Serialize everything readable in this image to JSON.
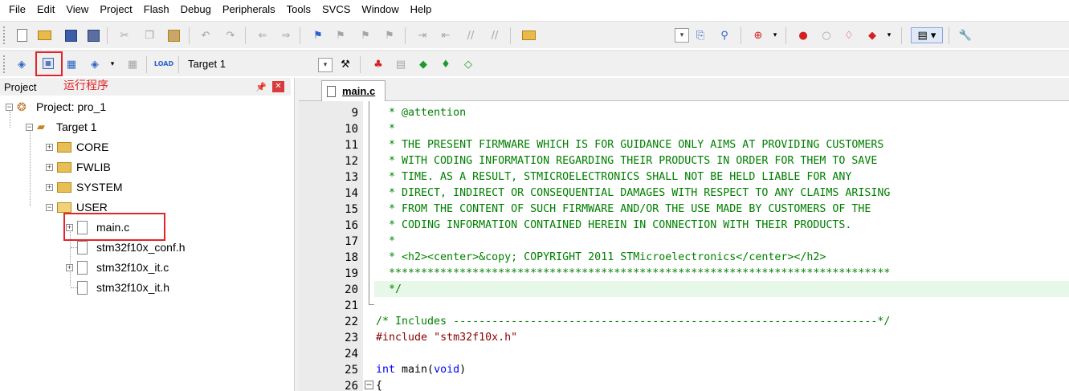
{
  "menu": [
    "File",
    "Edit",
    "View",
    "Project",
    "Flash",
    "Debug",
    "Peripherals",
    "Tools",
    "SVCS",
    "Window",
    "Help"
  ],
  "toolbar": {
    "target": "Target 1",
    "icons": [
      "new-file",
      "open",
      "save",
      "save-all",
      "cut",
      "copy",
      "paste",
      "undo",
      "redo",
      "navigate-back",
      "navigate-forward",
      "bookmark",
      "prev-bookmark",
      "next-bookmark",
      "clear-bookmarks",
      "indent",
      "unindent",
      "comment",
      "uncomment",
      "find-in-files",
      "find",
      "debug-session",
      "breakpoint",
      "step",
      "configure",
      "translate",
      "build",
      "rebuild",
      "batch-build",
      "stop-build",
      "download",
      "target-options",
      "manage-components"
    ]
  },
  "annotations": {
    "run_caption": "运行程序",
    "highlight_color": "#e2252b"
  },
  "project_panel": {
    "title": "Project",
    "tree": {
      "project": "Project: pro_1",
      "target": "Target 1",
      "groups": [
        "CORE",
        "FWLIB",
        "SYSTEM",
        "USER"
      ],
      "files": [
        "main.c",
        "stm32f10x_conf.h",
        "stm32f10x_it.c",
        "stm32f10x_it.h"
      ]
    }
  },
  "editor": {
    "tab": "main.c",
    "lines": [
      {
        "n": "9",
        "text": "  * @attention"
      },
      {
        "n": "10",
        "text": "  *"
      },
      {
        "n": "11",
        "text": "  * THE PRESENT FIRMWARE WHICH IS FOR GUIDANCE ONLY AIMS AT PROVIDING CUSTOMERS"
      },
      {
        "n": "12",
        "text": "  * WITH CODING INFORMATION REGARDING THEIR PRODUCTS IN ORDER FOR THEM TO SAVE"
      },
      {
        "n": "13",
        "text": "  * TIME. AS A RESULT, STMICROELECTRONICS SHALL NOT BE HELD LIABLE FOR ANY"
      },
      {
        "n": "14",
        "text": "  * DIRECT, INDIRECT OR CONSEQUENTIAL DAMAGES WITH RESPECT TO ANY CLAIMS ARISING"
      },
      {
        "n": "15",
        "text": "  * FROM THE CONTENT OF SUCH FIRMWARE AND/OR THE USE MADE BY CUSTOMERS OF THE"
      },
      {
        "n": "16",
        "text": "  * CODING INFORMATION CONTAINED HEREIN IN CONNECTION WITH THEIR PRODUCTS."
      },
      {
        "n": "17",
        "text": "  *"
      },
      {
        "n": "18",
        "text": "  * <h2><center>&copy; COPYRIGHT 2011 STMicroelectronics</center></h2>"
      },
      {
        "n": "19",
        "text": "  ******************************************************************************"
      },
      {
        "n": "20",
        "text": "  */"
      },
      {
        "n": "21",
        "text": ""
      },
      {
        "n": "22",
        "text": "/* Includes ------------------------------------------------------------------*/"
      },
      {
        "n": "23",
        "text_pre": "#include ",
        "text_str": "\"stm32f10x.h\""
      },
      {
        "n": "24",
        "text": ""
      },
      {
        "n": "25",
        "kw1": "int",
        "mid": " main(",
        "kw2": "void",
        "end": ")"
      },
      {
        "n": "26",
        "text": "{"
      }
    ]
  }
}
